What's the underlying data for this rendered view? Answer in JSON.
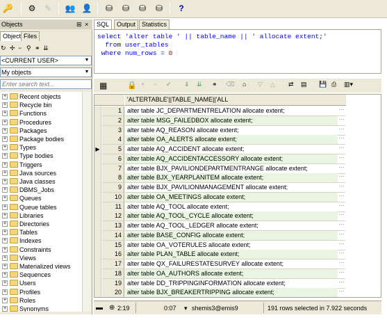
{
  "sql_tabs": [
    "SQL",
    "Output",
    "Statistics"
  ],
  "left_panel": {
    "title": "Objects",
    "tabs": [
      "Objects",
      "Files"
    ],
    "user_combo": "<CURRENT USER>",
    "objects_combo": "My objects",
    "filter_placeholder": "Enter search text...",
    "tree_items": [
      "Recent objects",
      "Recycle bin",
      "Functions",
      "Procedures",
      "Packages",
      "Package bodies",
      "Types",
      "Type bodies",
      "Triggers",
      "Java sources",
      "Java classes",
      "DBMS_Jobs",
      "Queues",
      "Queue tables",
      "Libraries",
      "Directories",
      "Tables",
      "Indexes",
      "Constraints",
      "Views",
      "Materialized views",
      "Sequences",
      "Users",
      "Profiles",
      "Roles",
      "Synonyms"
    ]
  },
  "editor": {
    "line1": {
      "kw": "select",
      "rest": " 'alter table ' || table_name || ' allocate extent;'"
    },
    "line2": {
      "kw": "from",
      "rest": " user_tables"
    },
    "line3": {
      "kw": "where",
      "rest": " num_rows = ",
      "num": "0"
    }
  },
  "grid": {
    "column_header": "'ALTERTABLE'||TABLE_NAME||'ALL",
    "current_row": 5,
    "rows": [
      "alter table JC_DEPARTMENTRELATION allocate extent;",
      "alter table MSG_FAILEDBOX allocate extent;",
      "alter table AQ_REASON allocate extent;",
      "alter table OA_ALERTS allocate extent;",
      "alter table AQ_ACCIDENT allocate extent;",
      "alter table AQ_ACCIDENTACCESSORY allocate extent;",
      "alter table BJX_PAVILIONDEPARTMENTRANGE allocate extent;",
      "alter table BJX_YEARPLANITEM allocate extent;",
      "alter table BJX_PAVILIONMANAGEMENT allocate extent;",
      "alter table OA_MEETINGS allocate extent;",
      "alter table AQ_TOOL allocate extent;",
      "alter table AQ_TOOL_CYCLE allocate extent;",
      "alter table AQ_TOOL_LEDGER allocate extent;",
      "alter table BASE_CONFIG allocate extent;",
      "alter table OA_VOTERULES allocate extent;",
      "alter table PLAN_TABLE allocate extent;",
      "alter table QX_FAILURESTATESURVEY allocate extent;",
      "alter table OA_AUTHORS allocate extent;",
      "alter table DD_TRIPPINGINFORMATION allocate extent;",
      "alter table BJX_BREAKERTRIPPING allocate extent;"
    ]
  },
  "status": {
    "position": "2:19",
    "time": "0:07",
    "connection": "shemis3@emis9",
    "rows_info": "191 rows selected in 7.922 seconds"
  }
}
